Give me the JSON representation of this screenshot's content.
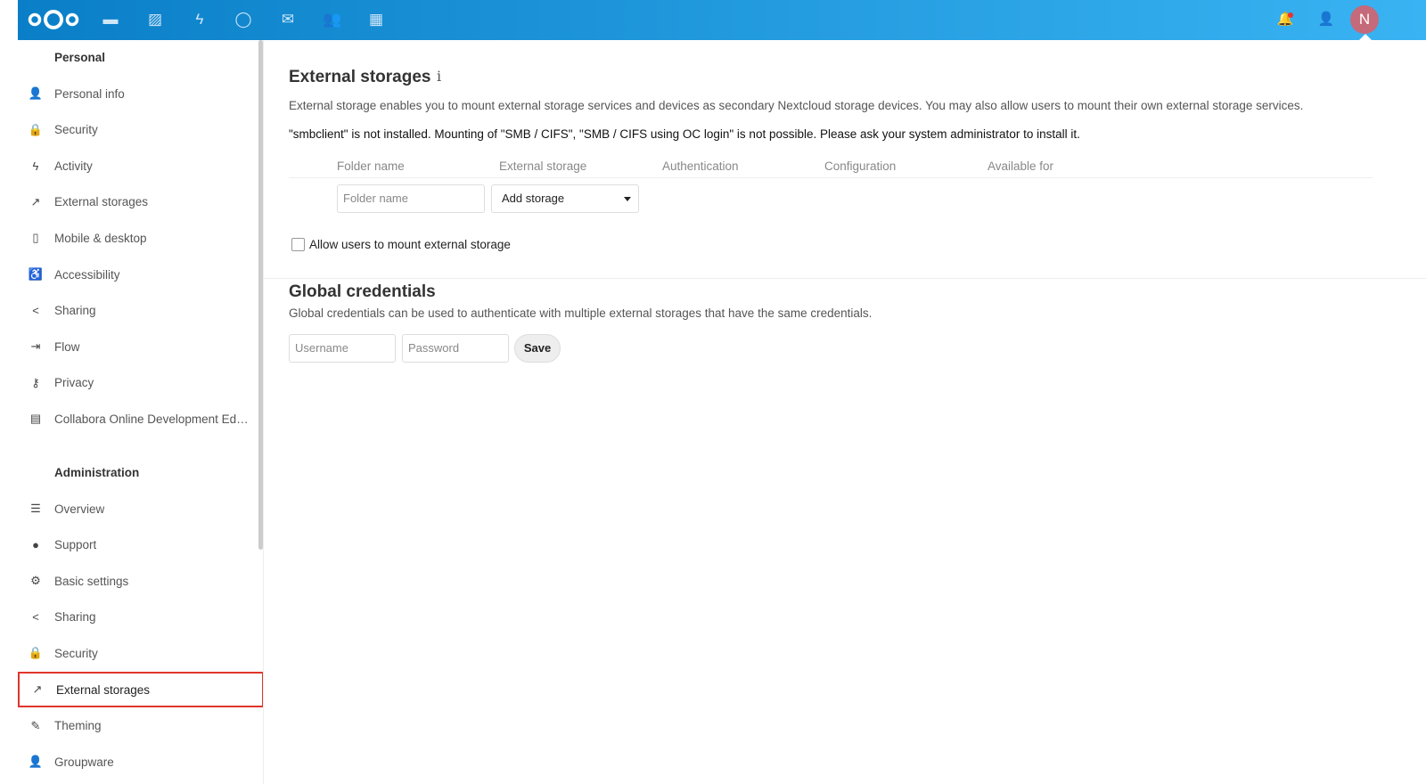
{
  "header": {
    "apps": [
      {
        "name": "files-icon",
        "glyph": "▬"
      },
      {
        "name": "photos-icon",
        "glyph": "▨"
      },
      {
        "name": "activity-icon",
        "glyph": "ϟ"
      },
      {
        "name": "talk-icon",
        "glyph": "◯"
      },
      {
        "name": "mail-icon",
        "glyph": "✉"
      },
      {
        "name": "contacts-icon",
        "glyph": "👥"
      },
      {
        "name": "calendar-icon",
        "glyph": "▦"
      }
    ],
    "avatar_initial": "N",
    "brand_color": "#0082c9",
    "notification_dot": "#e9322d"
  },
  "sidebar": {
    "personal_title": "Personal",
    "personal": [
      {
        "icon": "person-icon",
        "glyph": "👤",
        "label": "Personal info"
      },
      {
        "icon": "lock-icon",
        "glyph": "🔒",
        "label": "Security"
      },
      {
        "icon": "activity-icon",
        "glyph": "ϟ",
        "label": "Activity"
      },
      {
        "icon": "external-link-icon",
        "glyph": "↗",
        "label": "External storages"
      },
      {
        "icon": "phone-icon",
        "glyph": "▯",
        "label": "Mobile & desktop"
      },
      {
        "icon": "accessibility-icon",
        "glyph": "♿",
        "label": "Accessibility"
      },
      {
        "icon": "share-icon",
        "glyph": "<",
        "label": "Sharing"
      },
      {
        "icon": "flow-icon",
        "glyph": "⇥",
        "label": "Flow"
      },
      {
        "icon": "key-icon",
        "glyph": "⚷",
        "label": "Privacy"
      },
      {
        "icon": "document-icon",
        "glyph": "▤",
        "label": "Collabora Online Development Edition"
      }
    ],
    "admin_title": "Administration",
    "admin": [
      {
        "icon": "list-icon",
        "glyph": "☰",
        "label": "Overview"
      },
      {
        "icon": "comment-icon",
        "glyph": "●",
        "label": "Support"
      },
      {
        "icon": "gear-icon",
        "glyph": "⚙",
        "label": "Basic settings"
      },
      {
        "icon": "share-icon",
        "glyph": "<",
        "label": "Sharing"
      },
      {
        "icon": "lock-icon",
        "glyph": "🔒",
        "label": "Security"
      },
      {
        "icon": "external-link-icon",
        "glyph": "↗",
        "label": "External storages"
      },
      {
        "icon": "brush-icon",
        "glyph": "✎",
        "label": "Theming"
      },
      {
        "icon": "groupware-icon",
        "glyph": "👤",
        "label": "Groupware"
      }
    ]
  },
  "main": {
    "title": "External storages",
    "info_glyph": "i",
    "description": "External storage enables you to mount external storage services and devices as secondary Nextcloud storage devices. You may also allow users to mount their own external storage services.",
    "warning": "\"smbclient\" is not installed. Mounting of \"SMB / CIFS\", \"SMB / CIFS using OC login\" is not possible. Please ask your system administrator to install it.",
    "columns": [
      "Folder name",
      "External storage",
      "Authentication",
      "Configuration",
      "Available for"
    ],
    "folder_placeholder": "Folder name",
    "add_storage": "Add storage",
    "allow_users_label": "Allow users to mount external storage",
    "allow_users_checked": false,
    "global_title": "Global credentials",
    "global_desc": "Global credentials can be used to authenticate with multiple external storages that have the same credentials.",
    "username_placeholder": "Username",
    "password_placeholder": "Password",
    "save": "Save"
  }
}
